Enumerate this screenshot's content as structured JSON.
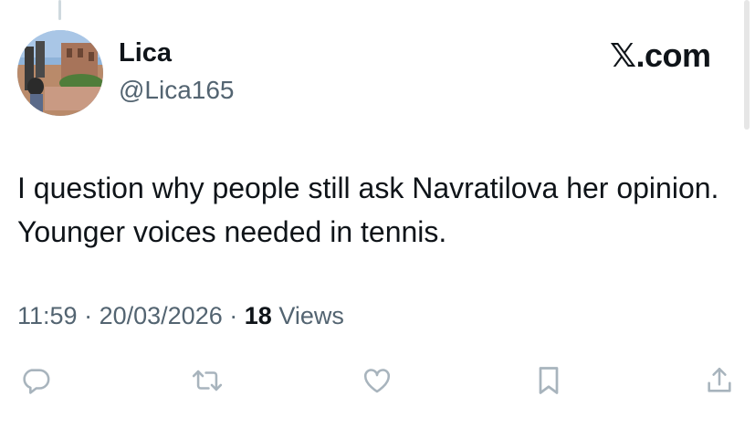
{
  "tweet": {
    "display_name": "Lica",
    "handle": "@Lica165",
    "text": "I question why people still ask Navratilova her opinion. Younger voices needed in tennis.",
    "time": "11:59",
    "separator": "·",
    "date": "20/03/2026",
    "views_count": "18",
    "views_label": "Views"
  },
  "brand": {
    "label": "𝕏.com"
  },
  "actions": [
    {
      "icon": "reply-icon"
    },
    {
      "icon": "retweet-icon"
    },
    {
      "icon": "like-icon"
    },
    {
      "icon": "bookmark-icon"
    },
    {
      "icon": "share-icon"
    }
  ],
  "colors": {
    "text_primary": "#0f1419",
    "text_secondary": "#536471",
    "icon_gray": "#a8b4bd",
    "thread_line": "#cfd9de"
  }
}
